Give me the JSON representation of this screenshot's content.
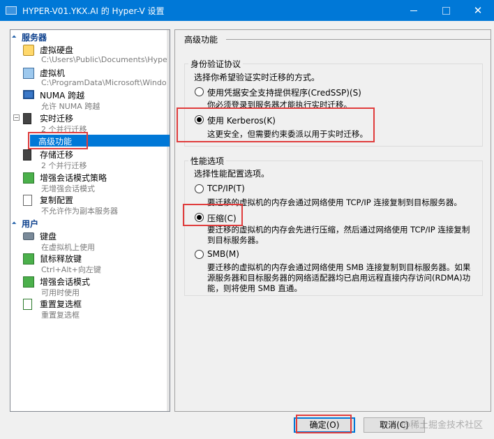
{
  "window": {
    "title": "HYPER-V01.YKX.AI 的 Hyper-V 设置",
    "close_glyph": "✕"
  },
  "sidebar": {
    "groups": [
      {
        "label": "服务器"
      },
      {
        "label": "用户"
      }
    ],
    "items": [
      {
        "label": "虚拟硬盘",
        "sub": "C:\\Users\\Public\\Documents\\Hyper-..."
      },
      {
        "label": "虚拟机",
        "sub": "C:\\ProgramData\\Microsoft\\Windo..."
      },
      {
        "label": "NUMA 跨越",
        "sub": "允许 NUMA 跨越"
      },
      {
        "label": "实时迁移",
        "sub": "2 个并行迁移",
        "expander": "−"
      },
      {
        "label": "高级功能",
        "sub": ""
      },
      {
        "label": "存储迁移",
        "sub": "2 个并行迁移"
      },
      {
        "label": "增强会话模式策略",
        "sub": "无增强会话模式"
      },
      {
        "label": "复制配置",
        "sub": "不允许作为副本服务器"
      },
      {
        "label": "键盘",
        "sub": "在虚拟机上使用"
      },
      {
        "label": "鼠标释放键",
        "sub": "Ctrl+Alt+向左键"
      },
      {
        "label": "增强会话模式",
        "sub": "可用时使用"
      },
      {
        "label": "重置复选框",
        "sub": "重置复选框"
      }
    ]
  },
  "main": {
    "heading": "高级功能",
    "auth": {
      "title": "身份验证协议",
      "prompt": "选择你希望验证实时迁移的方式。",
      "options": [
        {
          "label": "使用凭据安全支持提供程序(CredSSP)(S)",
          "desc": "你必须登录到服务器才能执行实时迁移。",
          "selected": false
        },
        {
          "label": "使用 Kerberos(K)",
          "desc": "这更安全，但需要约束委派以用于实时迁移。",
          "selected": true
        }
      ]
    },
    "perf": {
      "title": "性能选项",
      "prompt": "选择性能配置选项。",
      "options": [
        {
          "label": "TCP/IP(T)",
          "desc": "要迁移的虚拟机的内存会通过网络使用 TCP/IP 连接复制到目标服务器。",
          "selected": false
        },
        {
          "label": "压缩(C)",
          "desc": "要迁移的虚拟机的内存会先进行压缩，然后通过网络使用 TCP/IP 连接复制到目标服务器。",
          "selected": true
        },
        {
          "label": "SMB(M)",
          "desc": "要迁移的虚拟机的内存会通过网络使用 SMB 连接复制到目标服务器。如果源服务器和目标服务器的网络适配器均已启用远程直接内存访问(RDMA)功能，则将使用 SMB 直通。",
          "selected": false
        }
      ]
    }
  },
  "buttons": {
    "ok": "确定(O)",
    "cancel": "取消(C)"
  },
  "watermark": "@稀土掘金技术社区"
}
